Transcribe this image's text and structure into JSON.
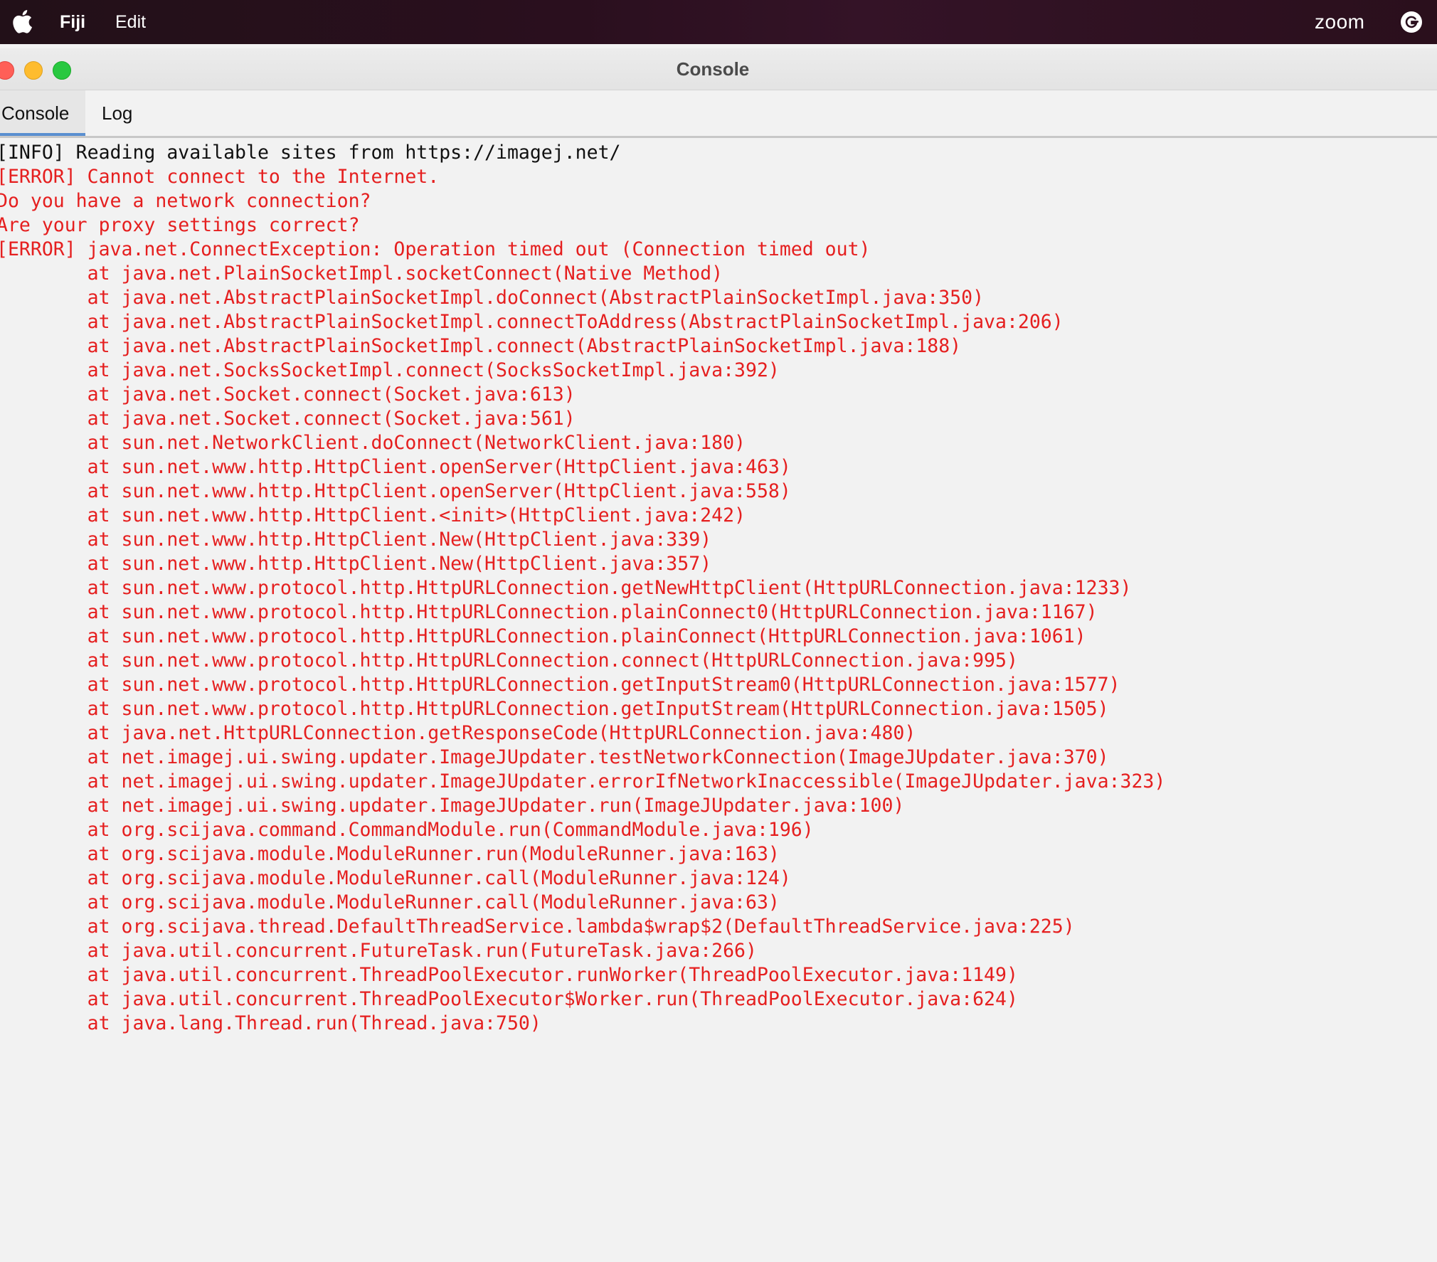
{
  "menubar": {
    "app_name": "Fiji",
    "edit_label": "Edit",
    "zoom_label": "zoom"
  },
  "window": {
    "title": "Console"
  },
  "tabs": [
    {
      "label": "Console",
      "selected": true
    },
    {
      "label": "Log",
      "selected": false
    }
  ],
  "colors": {
    "error_text": "#e51f1f",
    "info_text": "#111111",
    "selected_tab_underline": "#5a8fd0"
  },
  "console_lines": [
    {
      "type": "info",
      "text": "[INFO] Reading available sites from https://imagej.net/"
    },
    {
      "type": "error",
      "text": "[ERROR] Cannot connect to the Internet."
    },
    {
      "type": "error",
      "text": "Do you have a network connection?"
    },
    {
      "type": "error",
      "text": "Are your proxy settings correct?"
    },
    {
      "type": "error",
      "text": "[ERROR] java.net.ConnectException: Operation timed out (Connection timed out)"
    },
    {
      "type": "error",
      "text": "\tat java.net.PlainSocketImpl.socketConnect(Native Method)"
    },
    {
      "type": "error",
      "text": "\tat java.net.AbstractPlainSocketImpl.doConnect(AbstractPlainSocketImpl.java:350)"
    },
    {
      "type": "error",
      "text": "\tat java.net.AbstractPlainSocketImpl.connectToAddress(AbstractPlainSocketImpl.java:206)"
    },
    {
      "type": "error",
      "text": "\tat java.net.AbstractPlainSocketImpl.connect(AbstractPlainSocketImpl.java:188)"
    },
    {
      "type": "error",
      "text": "\tat java.net.SocksSocketImpl.connect(SocksSocketImpl.java:392)"
    },
    {
      "type": "error",
      "text": "\tat java.net.Socket.connect(Socket.java:613)"
    },
    {
      "type": "error",
      "text": "\tat java.net.Socket.connect(Socket.java:561)"
    },
    {
      "type": "error",
      "text": "\tat sun.net.NetworkClient.doConnect(NetworkClient.java:180)"
    },
    {
      "type": "error",
      "text": "\tat sun.net.www.http.HttpClient.openServer(HttpClient.java:463)"
    },
    {
      "type": "error",
      "text": "\tat sun.net.www.http.HttpClient.openServer(HttpClient.java:558)"
    },
    {
      "type": "error",
      "text": "\tat sun.net.www.http.HttpClient.<init>(HttpClient.java:242)"
    },
    {
      "type": "error",
      "text": "\tat sun.net.www.http.HttpClient.New(HttpClient.java:339)"
    },
    {
      "type": "error",
      "text": "\tat sun.net.www.http.HttpClient.New(HttpClient.java:357)"
    },
    {
      "type": "error",
      "text": "\tat sun.net.www.protocol.http.HttpURLConnection.getNewHttpClient(HttpURLConnection.java:1233)"
    },
    {
      "type": "error",
      "text": "\tat sun.net.www.protocol.http.HttpURLConnection.plainConnect0(HttpURLConnection.java:1167)"
    },
    {
      "type": "error",
      "text": "\tat sun.net.www.protocol.http.HttpURLConnection.plainConnect(HttpURLConnection.java:1061)"
    },
    {
      "type": "error",
      "text": "\tat sun.net.www.protocol.http.HttpURLConnection.connect(HttpURLConnection.java:995)"
    },
    {
      "type": "error",
      "text": "\tat sun.net.www.protocol.http.HttpURLConnection.getInputStream0(HttpURLConnection.java:1577)"
    },
    {
      "type": "error",
      "text": "\tat sun.net.www.protocol.http.HttpURLConnection.getInputStream(HttpURLConnection.java:1505)"
    },
    {
      "type": "error",
      "text": "\tat java.net.HttpURLConnection.getResponseCode(HttpURLConnection.java:480)"
    },
    {
      "type": "error",
      "text": "\tat net.imagej.ui.swing.updater.ImageJUpdater.testNetworkConnection(ImageJUpdater.java:370)"
    },
    {
      "type": "error",
      "text": "\tat net.imagej.ui.swing.updater.ImageJUpdater.errorIfNetworkInaccessible(ImageJUpdater.java:323)"
    },
    {
      "type": "error",
      "text": "\tat net.imagej.ui.swing.updater.ImageJUpdater.run(ImageJUpdater.java:100)"
    },
    {
      "type": "error",
      "text": "\tat org.scijava.command.CommandModule.run(CommandModule.java:196)"
    },
    {
      "type": "error",
      "text": "\tat org.scijava.module.ModuleRunner.run(ModuleRunner.java:163)"
    },
    {
      "type": "error",
      "text": "\tat org.scijava.module.ModuleRunner.call(ModuleRunner.java:124)"
    },
    {
      "type": "error",
      "text": "\tat org.scijava.module.ModuleRunner.call(ModuleRunner.java:63)"
    },
    {
      "type": "error",
      "text": "\tat org.scijava.thread.DefaultThreadService.lambda$wrap$2(DefaultThreadService.java:225)"
    },
    {
      "type": "error",
      "text": "\tat java.util.concurrent.FutureTask.run(FutureTask.java:266)"
    },
    {
      "type": "error",
      "text": "\tat java.util.concurrent.ThreadPoolExecutor.runWorker(ThreadPoolExecutor.java:1149)"
    },
    {
      "type": "error",
      "text": "\tat java.util.concurrent.ThreadPoolExecutor$Worker.run(ThreadPoolExecutor.java:624)"
    },
    {
      "type": "error",
      "text": "\tat java.lang.Thread.run(Thread.java:750)"
    }
  ]
}
